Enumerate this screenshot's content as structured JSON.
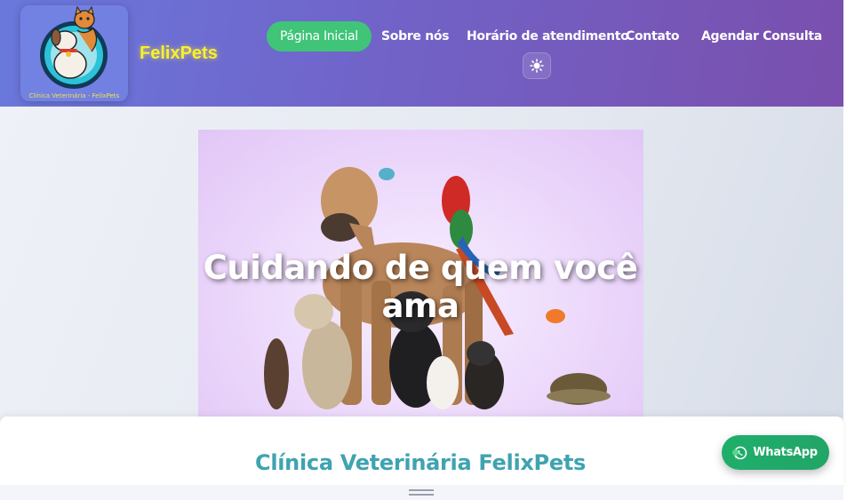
{
  "header": {
    "brand": "FelixPets",
    "logo_caption": "Clínica Veterinária - FelixPets",
    "logo_icon": "cat-and-dog-logo",
    "nav": [
      {
        "label": "Página Inicial",
        "active": true
      },
      {
        "label": "Sobre nós",
        "active": false
      },
      {
        "label": "Horário de atendimento",
        "active": false
      },
      {
        "label": "Contato",
        "active": false
      },
      {
        "label": "Agendar Consulta",
        "active": false
      }
    ],
    "theme_toggle_icon": "sun-icon"
  },
  "hero": {
    "title": "Cuidando de quem você ama",
    "image_icon": "pets-group-image"
  },
  "main": {
    "section_title": "Clínica Veterinária FelixPets"
  },
  "whatsapp": {
    "label": "WhatsApp",
    "icon": "whatsapp-icon"
  },
  "colors": {
    "header_start": "#6a78dc",
    "header_end": "#7a4fad",
    "active_nav": "#3fc478",
    "brand": "#f7f02b",
    "section_title": "#3fa3b0",
    "whatsapp": "#1fae6a"
  }
}
